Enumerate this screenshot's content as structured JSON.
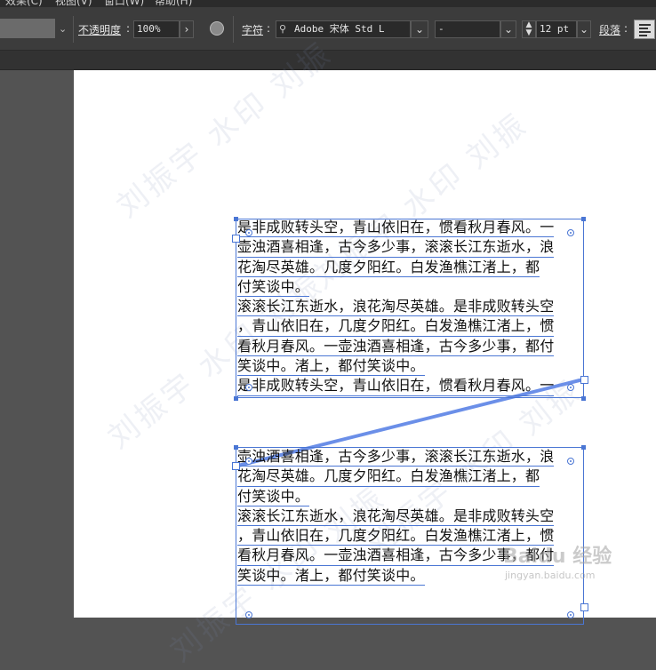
{
  "menu": {
    "items": [
      "效果(C)",
      "视图(V)",
      "窗口(W)",
      "帮助(H)"
    ]
  },
  "control_panel": {
    "opacity_label": "不透明度",
    "opacity_value": "100%",
    "char_label": "字符",
    "font_family": "Adobe 宋体 Std L",
    "font_style": "-",
    "font_size": "12 pt",
    "para_label": "段落"
  },
  "frame1": {
    "lines": [
      "是非成败转头空，青山依旧在，惯看秋月春风。一",
      "壶浊酒喜相逢，古今多少事，滚滚长江东逝水，浪",
      "花淘尽英雄。几度夕阳红。白发渔樵江渚上，都",
      "付笑谈中。",
      "滚滚长江东逝水，浪花淘尽英雄。是非成败转头空",
      "，青山依旧在，几度夕阳红。白发渔樵江渚上，惯",
      "看秋月春风。一壶浊酒喜相逢，古今多少事，都付",
      "笑谈中。渚上，都付笑谈中。",
      "是非成败转头空，青山依旧在，惯看秋月春风。一"
    ]
  },
  "frame2": {
    "lines": [
      "壶浊酒喜相逢，古今多少事，滚滚长江东逝水，浪",
      "花淘尽英雄。几度夕阳红。白发渔樵江渚上，都",
      "付笑谈中。",
      "滚滚长江东逝水，浪花淘尽英雄。是非成败转头空",
      "，青山依旧在，几度夕阳红。白发渔樵江渚上，惯",
      "看秋月春风。一壶浊酒喜相逢，古今多少事，都付",
      "笑谈中。渚上，都付笑谈中。"
    ]
  },
  "watermark": {
    "text": "刘振宇 水印 刘振",
    "baidu": "Baidu 经验",
    "baidu_url": "jingyan.baidu.com"
  },
  "colors": {
    "selection": "#4a76d4",
    "thread": "#6b8fe8"
  }
}
